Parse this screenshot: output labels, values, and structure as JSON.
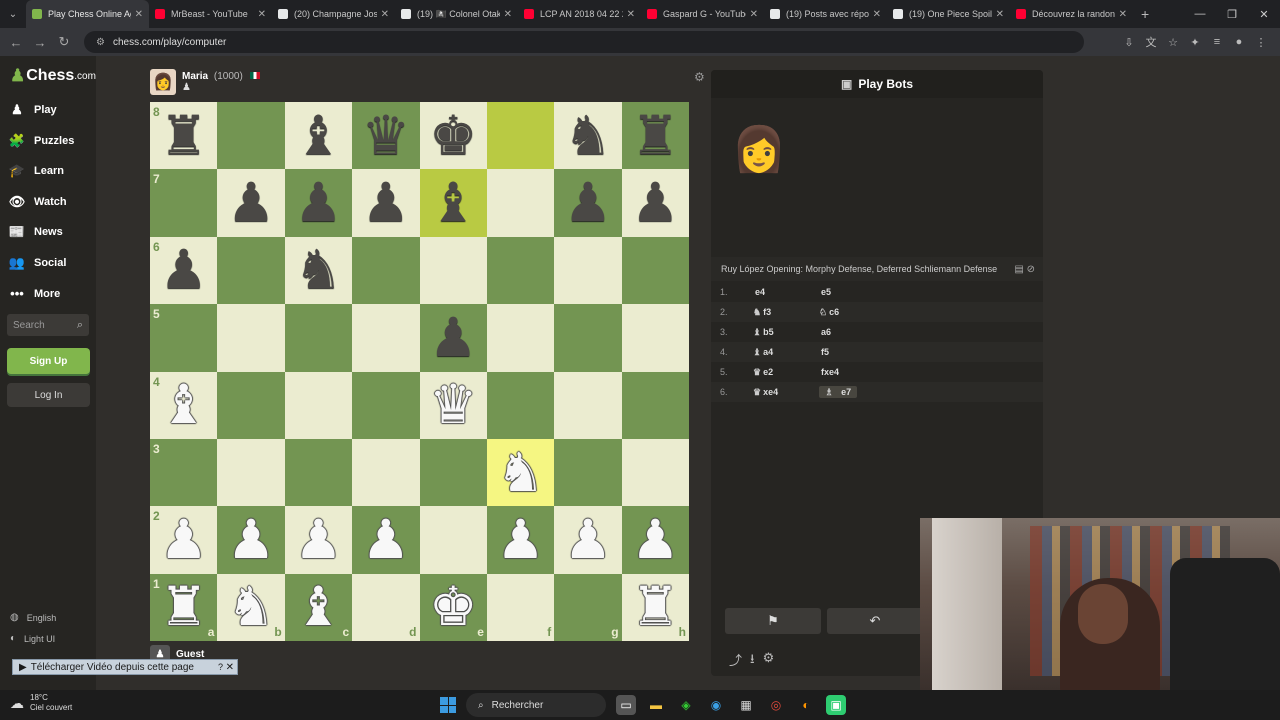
{
  "browser": {
    "tabs": [
      {
        "title": "Play Chess Online Ag",
        "color": "#81b64c",
        "active": true
      },
      {
        "title": "MrBeast - YouTube",
        "color": "#ff0033",
        "active": false
      },
      {
        "title": "(20) Champagne Josh",
        "color": "#e7e9ea",
        "active": false
      },
      {
        "title": "(19) 🏴‍☠️ Colonel Otaku",
        "color": "#e7e9ea",
        "active": false
      },
      {
        "title": "LCP AN 2018 04 22 2",
        "color": "#ff0033",
        "active": false
      },
      {
        "title": "Gaspard G - YouTube",
        "color": "#ff0033",
        "active": false
      },
      {
        "title": "(19) Posts avec répo",
        "color": "#e7e9ea",
        "active": false
      },
      {
        "title": "(19) One Piece Spoil",
        "color": "#e7e9ea",
        "active": false
      },
      {
        "title": "Découvrez la randon",
        "color": "#ff0033",
        "active": false
      }
    ],
    "url": "chess.com/play/computer"
  },
  "sidebar": {
    "logo": {
      "name": "Chess",
      "suffix": ".com"
    },
    "items": [
      {
        "label": "Play",
        "icon": "♟"
      },
      {
        "label": "Puzzles",
        "icon": "🧩"
      },
      {
        "label": "Learn",
        "icon": "🎓"
      },
      {
        "label": "Watch",
        "icon": "👁"
      },
      {
        "label": "News",
        "icon": "📰"
      },
      {
        "label": "Social",
        "icon": "👥"
      },
      {
        "label": "More",
        "icon": "•••"
      }
    ],
    "search_placeholder": "Search",
    "signup": "Sign Up",
    "login": "Log In",
    "language": "English",
    "theme": "Light UI"
  },
  "game": {
    "opponent": {
      "name": "Maria",
      "rating": "(1000)"
    },
    "player": {
      "name": "Guest"
    },
    "ranks": [
      "8",
      "7",
      "6",
      "5",
      "4",
      "3",
      "2",
      "1"
    ],
    "files": [
      "a",
      "b",
      "c",
      "d",
      "e",
      "f",
      "g",
      "h"
    ],
    "board": [
      [
        "bR",
        "",
        "bB",
        "bQ",
        "bK",
        "",
        "bN",
        "bR"
      ],
      [
        "",
        "bP",
        "bP",
        "bP",
        "bB",
        "",
        "bP",
        "bP"
      ],
      [
        "bP",
        "",
        "bN",
        "",
        "",
        "",
        "",
        ""
      ],
      [
        "",
        "",
        "",
        "",
        "bP",
        "",
        "",
        ""
      ],
      [
        "wB",
        "",
        "",
        "",
        "wQ",
        "",
        "",
        ""
      ],
      [
        "",
        "",
        "",
        "",
        "",
        "wN",
        "",
        ""
      ],
      [
        "wP",
        "wP",
        "wP",
        "wP",
        "",
        "wP",
        "wP",
        "wP"
      ],
      [
        "wR",
        "wN",
        "wB",
        "",
        "wK",
        "",
        "",
        "wR"
      ]
    ],
    "highlights": [
      [
        0,
        5
      ],
      [
        1,
        4
      ],
      [
        5,
        5
      ]
    ]
  },
  "panel": {
    "title": "Play Bots",
    "opening": "Ruy López Opening: Morphy Defense, Deferred Schliemann Defense",
    "moves": [
      {
        "num": "1.",
        "white": "e4",
        "wfig": "",
        "black": "e5",
        "bfig": ""
      },
      {
        "num": "2.",
        "white": "f3",
        "wfig": "♞",
        "black": "c6",
        "bfig": "♘"
      },
      {
        "num": "3.",
        "white": "b5",
        "wfig": "♝",
        "black": "a6",
        "bfig": ""
      },
      {
        "num": "4.",
        "white": "a4",
        "wfig": "♝",
        "black": "f5",
        "bfig": ""
      },
      {
        "num": "5.",
        "white": "e2",
        "wfig": "♛",
        "black": "fxe4",
        "bfig": ""
      },
      {
        "num": "6.",
        "white": "xe4",
        "wfig": "♛",
        "black": "e7",
        "bfig": "♗"
      }
    ]
  },
  "download_bar": {
    "label": "Télécharger Vidéo depuis cette page"
  },
  "taskbar": {
    "temp": "18°C",
    "weather": "Ciel couvert",
    "search": "Rechercher"
  }
}
